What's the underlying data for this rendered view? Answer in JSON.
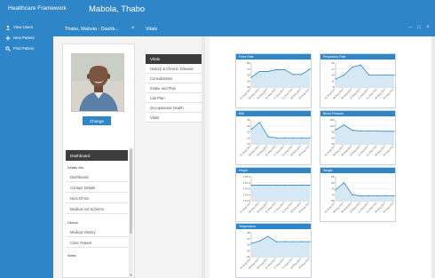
{
  "app": {
    "title": "Healthcare Framework",
    "patient_name": "Mabola, Thabo"
  },
  "nav": {
    "items": [
      {
        "label": "View Users",
        "icon": "users-icon"
      },
      {
        "label": "New Patient",
        "icon": "plus-icon"
      },
      {
        "label": "Find Patient",
        "icon": "search-icon"
      }
    ]
  },
  "tabs": {
    "patient_tab": "Thabo, Mabola - Dashb...",
    "close_glyph": "×",
    "vitals_tab": "Vitals",
    "window_controls": [
      "–",
      "□",
      "×"
    ]
  },
  "patient_panel": {
    "change_button": "Change",
    "dashboard_header": "Dashboard",
    "sections": [
      {
        "label": "Details Info",
        "items": [
          "Dashboard",
          "Contact Details",
          "Next Of Kin",
          "Medical Aid Scheme"
        ]
      },
      {
        "label": "Clinical",
        "items": [
          "Medical History",
          "Clinic Patient"
        ]
      },
      {
        "label": "Notes",
        "items": []
      }
    ]
  },
  "vitals_menu": {
    "header": "Vitals",
    "items": [
      "History & Chronic Disease",
      "Consultations",
      "Intake and Plan",
      "Lab Plan",
      "Occupational Health",
      "Vitals"
    ]
  },
  "charts": [
    {
      "title": "Pulse Rate",
      "ticks": [
        "80",
        "70",
        "60",
        "50",
        "40"
      ]
    },
    {
      "title": "Respiratory Rate",
      "ticks": [
        "20",
        "17",
        "14",
        "11",
        "8"
      ]
    },
    {
      "title": "BMI",
      "ticks": [
        "30",
        "25",
        "20",
        "15",
        "10"
      ]
    },
    {
      "title": "Blood Pressure",
      "ticks": [
        "150",
        "120",
        "90",
        "60",
        "30"
      ]
    },
    {
      "title": "Height",
      "ticks": [
        "175.5",
        "175.0",
        "174.5",
        "174.0",
        "173.5"
      ]
    },
    {
      "title": "Weight",
      "ticks": [
        "85",
        "80",
        "75",
        "70",
        "65"
      ]
    },
    {
      "title": "Temperature",
      "ticks": [
        "38",
        "37",
        "36",
        "35",
        "34"
      ]
    }
  ],
  "chart_data": [
    {
      "type": "area",
      "title": "Pulse Rate",
      "x": [
        "01-Aug-2017",
        "05-Aug-2017",
        "09-Aug-2017",
        "13-Aug-2017",
        "17-Aug-2017",
        "21-Aug-2017",
        "25-Aug-2017",
        "29-Aug-2017"
      ],
      "values": [
        56,
        66,
        66,
        69,
        69,
        61,
        61,
        70
      ],
      "ylim": [
        40,
        80
      ]
    },
    {
      "type": "area",
      "title": "Respiratory Rate",
      "x": [
        "01-Aug-2017",
        "05-Aug-2017",
        "09-Aug-2017",
        "13-Aug-2017",
        "17-Aug-2017",
        "21-Aug-2017",
        "25-Aug-2017",
        "29-Aug-2017"
      ],
      "values": [
        12,
        14,
        18,
        19,
        14,
        14,
        14,
        14
      ],
      "ylim": [
        8,
        20
      ]
    },
    {
      "type": "area",
      "title": "BMI",
      "x": [
        "01-Aug-2017",
        "05-Aug-2017",
        "09-Aug-2017",
        "13-Aug-2017",
        "17-Aug-2017",
        "21-Aug-2017",
        "25-Aug-2017",
        "29-Aug-2017"
      ],
      "values": [
        22,
        28,
        16,
        15,
        15,
        15,
        15,
        15
      ],
      "ylim": [
        10,
        30
      ]
    },
    {
      "type": "area",
      "title": "Blood Pressure",
      "x": [
        "01-Aug-2017",
        "05-Aug-2017",
        "09-Aug-2017",
        "13-Aug-2017",
        "17-Aug-2017",
        "21-Aug-2017",
        "25-Aug-2017",
        "29-Aug-2017"
      ],
      "values": [
        100,
        125,
        98,
        95,
        94,
        94,
        93,
        93
      ],
      "ylim": [
        30,
        150
      ]
    },
    {
      "type": "area",
      "title": "Height",
      "x": [
        "01-Aug-2017",
        "05-Aug-2017",
        "09-Aug-2017",
        "13-Aug-2017",
        "17-Aug-2017",
        "21-Aug-2017",
        "25-Aug-2017",
        "29-Aug-2017"
      ],
      "values": [
        174.8,
        174.8,
        174.8,
        174.8,
        174.8,
        174.8,
        174.8,
        174.8
      ],
      "ylim": [
        173.5,
        175.5
      ]
    },
    {
      "type": "area",
      "title": "Weight",
      "x": [
        "01-Aug-2017",
        "05-Aug-2017",
        "09-Aug-2017",
        "13-Aug-2017",
        "17-Aug-2017",
        "21-Aug-2017",
        "25-Aug-2017",
        "29-Aug-2017"
      ],
      "values": [
        74,
        80,
        70,
        69,
        69,
        69,
        69,
        69
      ],
      "ylim": [
        65,
        85
      ]
    },
    {
      "type": "area",
      "title": "Temperature",
      "x": [
        "01-Aug-2017",
        "05-Aug-2017",
        "09-Aug-2017",
        "13-Aug-2017",
        "17-Aug-2017",
        "21-Aug-2017",
        "25-Aug-2017",
        "29-Aug-2017"
      ],
      "values": [
        36.2,
        36.6,
        37.4,
        36.5,
        36.5,
        36.5,
        36.5,
        36.5
      ],
      "ylim": [
        34,
        38
      ]
    }
  ],
  "colors": {
    "brand": "#2e86c8",
    "dark_header": "#3c3c3c",
    "chart_line": "#2e86c8",
    "chart_fill": "#d7e8f5"
  }
}
